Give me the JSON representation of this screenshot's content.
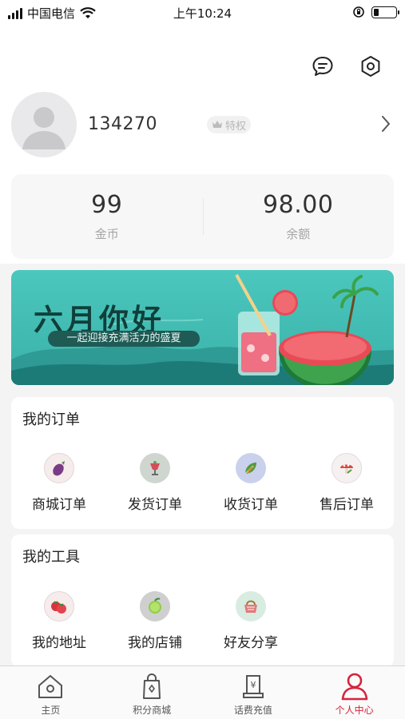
{
  "status_bar": {
    "carrier": "中国电信",
    "time": "上午10:24"
  },
  "header": {
    "icons": [
      "message-icon",
      "settings-icon"
    ]
  },
  "profile": {
    "username": "134270",
    "badge": "特权"
  },
  "stats": [
    {
      "value": "99",
      "label": "金币"
    },
    {
      "value": "98.00",
      "label": "余额"
    }
  ],
  "banner": {
    "title": "六月你好",
    "subtitle": "一起迎接充满活力的盛夏"
  },
  "orders": {
    "title": "我的订单",
    "items": [
      {
        "label": "商城订单",
        "icon": "eggplant-icon",
        "color": "#f4e7e7"
      },
      {
        "label": "发货订单",
        "icon": "cup-icon",
        "color": "#cfd6cf"
      },
      {
        "label": "收货订单",
        "icon": "leaf-icon",
        "color": "#c9d1ec"
      },
      {
        "label": "售后订单",
        "icon": "mushroom-icon",
        "color": "#f3ecec"
      }
    ]
  },
  "tools": {
    "title": "我的工具",
    "items": [
      {
        "label": "我的地址",
        "icon": "tomato-icon",
        "color": "#f4e7e7"
      },
      {
        "label": "我的店铺",
        "icon": "lime-icon",
        "color": "#cfcfcf"
      },
      {
        "label": "好友分享",
        "icon": "basket-icon",
        "color": "#d8ece2"
      }
    ]
  },
  "tabbar": {
    "items": [
      {
        "label": "主页",
        "icon": "home-icon"
      },
      {
        "label": "积分商城",
        "icon": "shopping-bag-icon"
      },
      {
        "label": "话费充值",
        "icon": "phone-bill-icon"
      },
      {
        "label": "个人中心",
        "icon": "person-icon"
      }
    ],
    "active_index": 3,
    "active_color": "#d6243b"
  }
}
